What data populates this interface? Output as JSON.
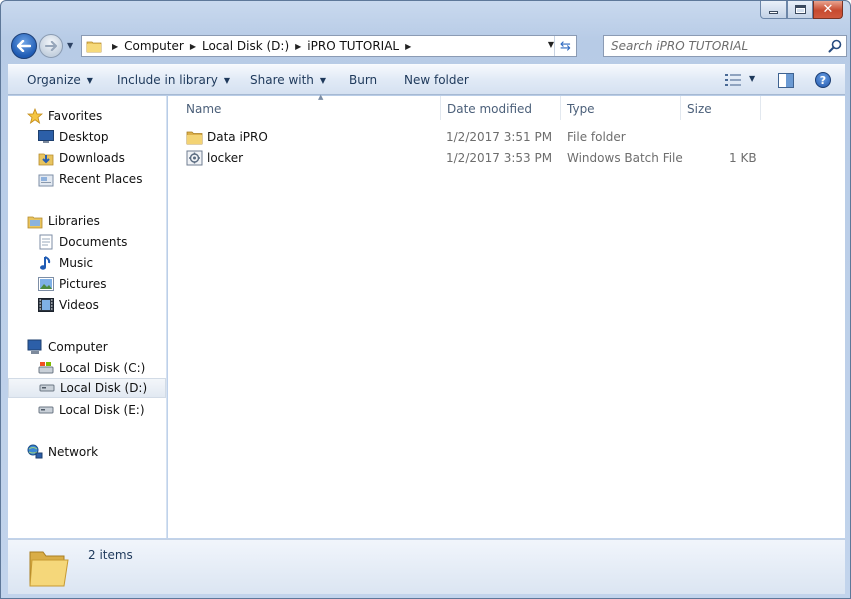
{
  "address": {
    "crumbs": [
      "Computer",
      "Local Disk (D:)",
      "iPRO TUTORIAL"
    ]
  },
  "search": {
    "placeholder": "Search iPRO TUTORIAL"
  },
  "toolbar": {
    "organize": "Organize",
    "include_in_library": "Include in library",
    "share_with": "Share with",
    "burn": "Burn",
    "new_folder": "New folder",
    "help": "?"
  },
  "sidebar": {
    "items": [
      {
        "label": "Favorites",
        "icon": "star-icon"
      },
      {
        "label": "Desktop",
        "icon": "desktop-icon"
      },
      {
        "label": "Downloads",
        "icon": "downloads-icon"
      },
      {
        "label": "Recent Places",
        "icon": "recent-places-icon"
      },
      {
        "label": "Libraries",
        "icon": "libraries-icon"
      },
      {
        "label": "Documents",
        "icon": "documents-icon"
      },
      {
        "label": "Music",
        "icon": "music-icon"
      },
      {
        "label": "Pictures",
        "icon": "pictures-icon"
      },
      {
        "label": "Videos",
        "icon": "videos-icon"
      },
      {
        "label": "Computer",
        "icon": "computer-icon"
      },
      {
        "label": "Local Disk (C:)",
        "icon": "drive-icon"
      },
      {
        "label": "Local Disk (D:)",
        "icon": "drive-icon",
        "selected": true
      },
      {
        "label": "Local Disk (E:)",
        "icon": "drive-icon"
      },
      {
        "label": "Network",
        "icon": "network-icon"
      }
    ]
  },
  "columns": {
    "name": "Name",
    "date_modified": "Date modified",
    "type": "Type",
    "size": "Size"
  },
  "files": [
    {
      "name": "Data iPRO",
      "date_modified": "1/2/2017 3:51 PM",
      "type": "File folder",
      "size": "",
      "icon": "folder-icon"
    },
    {
      "name": "locker",
      "date_modified": "1/2/2017 3:53 PM",
      "type": "Windows Batch File",
      "size": "1 KB",
      "icon": "batch-file-icon"
    }
  ],
  "details": {
    "item_count": "2 items"
  },
  "colors": {
    "accent": "#1e395b",
    "selection": "#e2e9f2",
    "chrome": "#c2d4ec"
  }
}
